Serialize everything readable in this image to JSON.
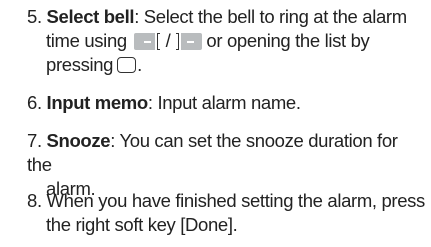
{
  "steps": [
    {
      "number": "5.",
      "title": "Select bell",
      "text_a": ": Select the bell to ring at the alarm",
      "text_b": "time using",
      "slash": "/",
      "text_c": "or opening the list by",
      "text_d": "pressing",
      "text_e": "."
    },
    {
      "number": "6.",
      "title": "Input memo",
      "text_a": ": Input alarm name."
    },
    {
      "number": "7.",
      "title": "Snooze",
      "text_a": ": You can set the snooze duration for the",
      "text_b": "alarm."
    },
    {
      "number": "8.",
      "text_a": "When you have finished setting the alarm, press",
      "text_b": "the right soft key [Done]."
    }
  ],
  "icons": {
    "left_key": "nav-left-key-icon",
    "right_key": "nav-right-key-icon",
    "ok_key": "ok-key-icon"
  }
}
